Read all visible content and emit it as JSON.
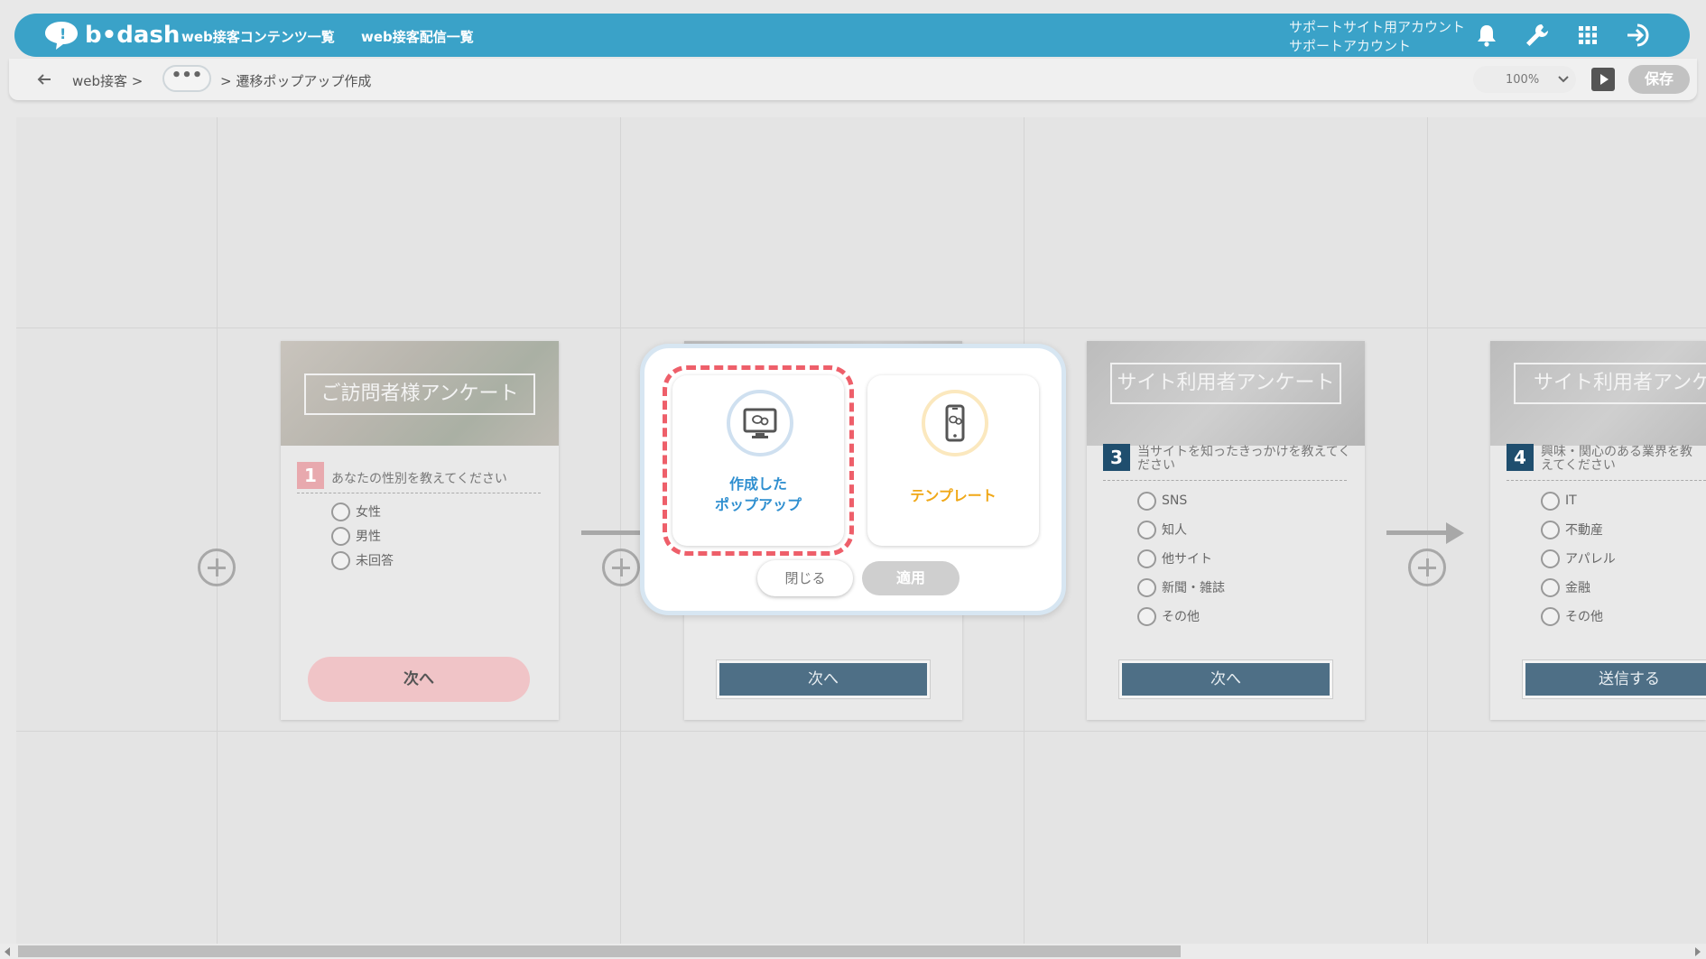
{
  "header": {
    "logo_text": "b•dash",
    "nav": [
      "web接客コンテンツ一覧",
      "web接客配信一覧"
    ],
    "account_line1": "サポートサイト用アカウント",
    "account_line2": "サポートアカウント",
    "icons": [
      "bell-icon",
      "wrench-icon",
      "grid-icon",
      "logout-icon"
    ],
    "accent_color": "#3aa2c8"
  },
  "subbar": {
    "crumb_root": "web接客 >",
    "crumb_more": "•••",
    "crumb_current": "> 遷移ポップアップ作成",
    "zoom": "100%",
    "save_label": "保存"
  },
  "cards": [
    {
      "hero_title": "ご訪問者様アンケート",
      "q_number": "1",
      "question": "あなたの性別を教えてください",
      "options": [
        "女性",
        "男性",
        "未回答"
      ],
      "button": "次へ"
    },
    {
      "button": "次へ"
    },
    {
      "hero_title": "サイト利用者アンケート",
      "q_number": "3",
      "question": "当サイトを知ったきっかけを教えてください",
      "options": [
        "SNS",
        "知人",
        "他サイト",
        "新聞・雑誌",
        "その他"
      ],
      "button": "次へ"
    },
    {
      "hero_title": "サイト利用者アンケート",
      "q_number": "4",
      "question": "興味・関心のある業界を教えてください",
      "options": [
        "IT",
        "不動産",
        "アパレル",
        "金融",
        "その他"
      ],
      "button": "送信する"
    }
  ],
  "modal": {
    "option_created_line1": "作成した",
    "option_created_line2": "ポップアップ",
    "option_template": "テンプレート",
    "close_label": "閉じる",
    "apply_label": "適用",
    "created_color": "#2f8fd0",
    "template_color": "#f0a818",
    "selected_outline_color": "#ee5f6a"
  }
}
